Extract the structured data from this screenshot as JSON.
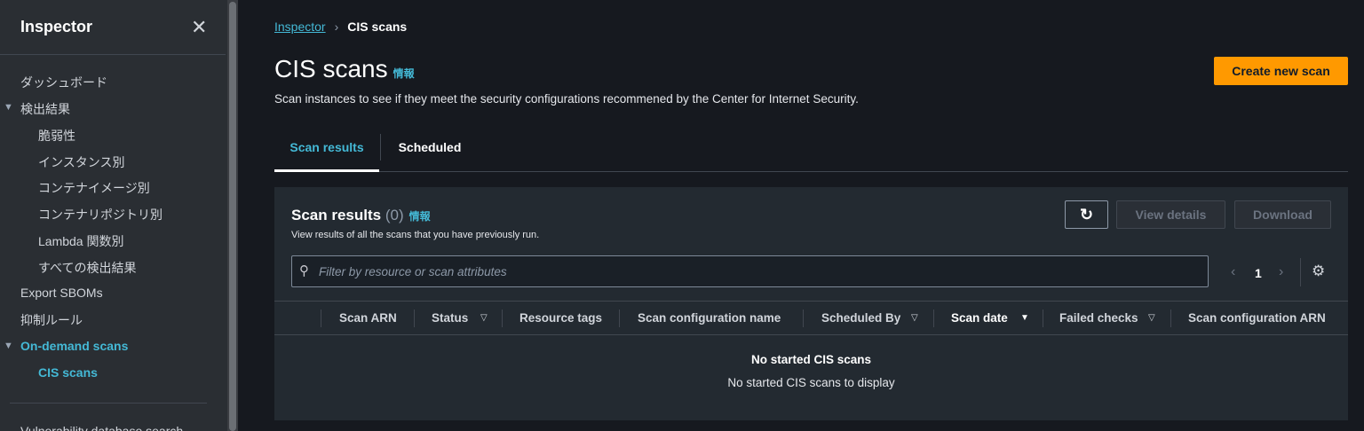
{
  "sidebar": {
    "title": "Inspector",
    "items": [
      {
        "label": "ダッシュボード"
      },
      {
        "label": "検出結果"
      },
      {
        "label": "脆弱性"
      },
      {
        "label": "インスタンス別"
      },
      {
        "label": "コンテナイメージ別"
      },
      {
        "label": "コンテナリポジトリ別"
      },
      {
        "label": "Lambda 関数別"
      },
      {
        "label": "すべての検出結果"
      },
      {
        "label": "Export SBOMs"
      },
      {
        "label": "抑制ルール"
      },
      {
        "label": "On-demand scans"
      },
      {
        "label": "CIS scans"
      },
      {
        "label": "Vulnerability database search"
      }
    ]
  },
  "breadcrumb": {
    "root": "Inspector",
    "current": "CIS scans"
  },
  "header": {
    "title": "CIS scans",
    "info": "情報",
    "description": "Scan instances to see if they meet the security configurations recommened by the Center for Internet Security.",
    "create_label": "Create new scan"
  },
  "tabs": [
    {
      "label": "Scan results"
    },
    {
      "label": "Scheduled"
    }
  ],
  "panel": {
    "title": "Scan results",
    "count": "(0)",
    "info": "情報",
    "subtitle": "View results of all the scans that you have previously run.",
    "view_details": "View details",
    "download": "Download",
    "filter_placeholder": "Filter by resource or scan attributes",
    "page": "1"
  },
  "columns": [
    {
      "label": "Scan ARN"
    },
    {
      "label": "Status"
    },
    {
      "label": "Resource tags"
    },
    {
      "label": "Scan configuration name"
    },
    {
      "label": "Scheduled By"
    },
    {
      "label": "Scan date"
    },
    {
      "label": "Failed checks"
    },
    {
      "label": "Scan configuration ARN"
    }
  ],
  "empty": {
    "title": "No started CIS scans",
    "message": "No started CIS scans to display"
  }
}
